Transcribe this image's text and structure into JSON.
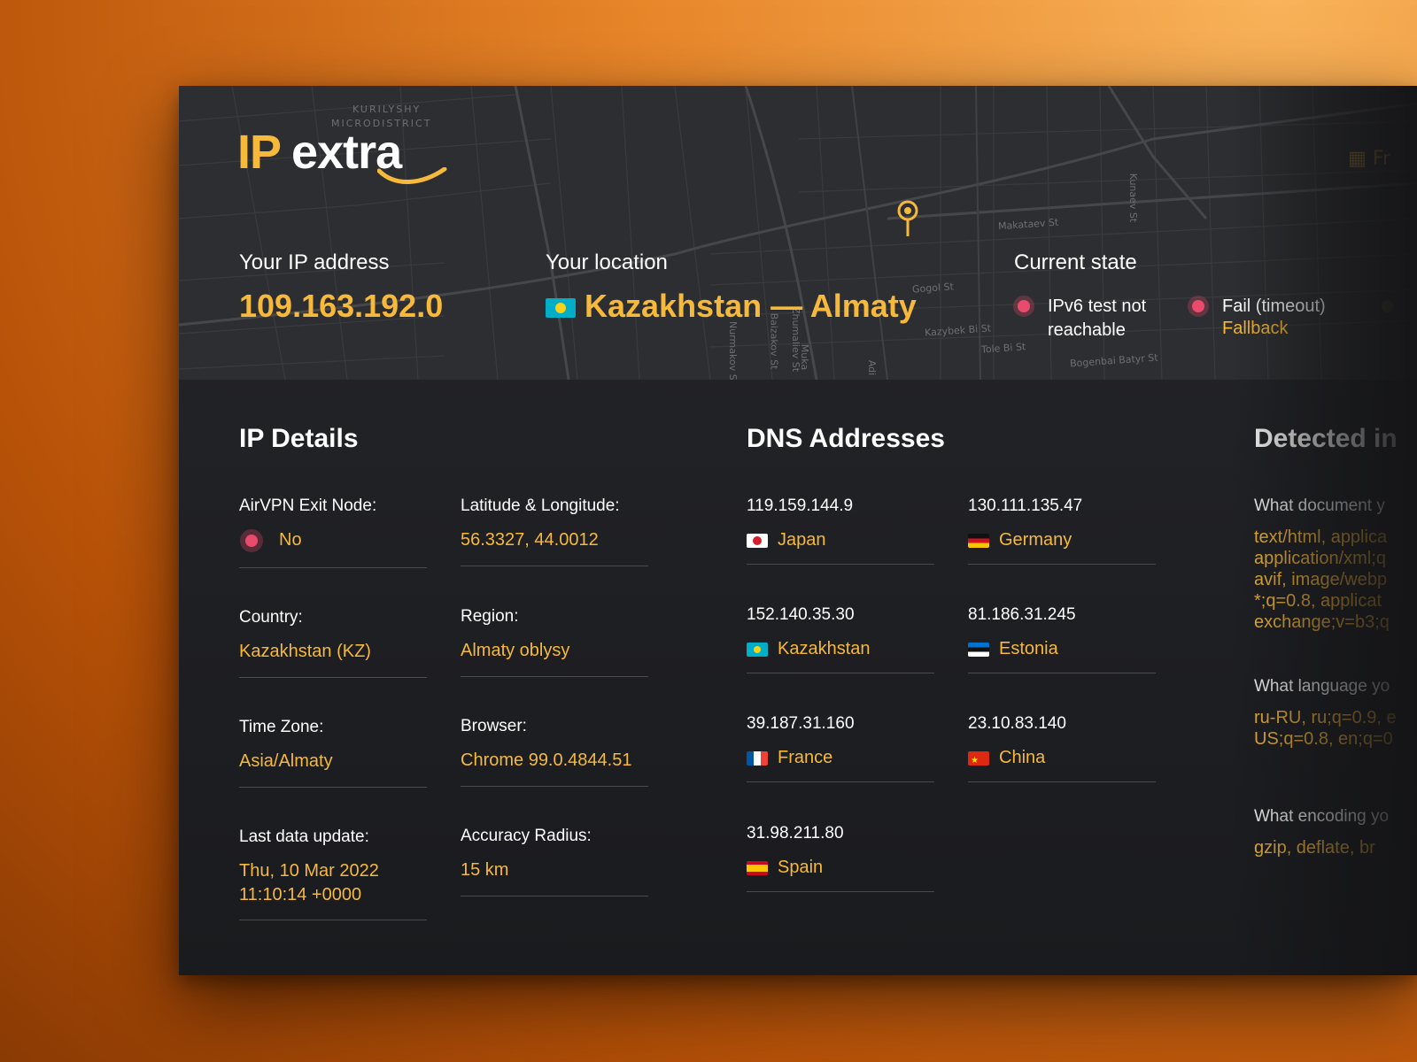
{
  "logo": {
    "ip": "IP",
    "extra": "extra"
  },
  "map_labels": {
    "district_line1": "KURILYSHY",
    "district_line2": "MICRODISTRICT",
    "streets": [
      "Makataev St",
      "Gogol St",
      "Kazybek Bi St",
      "Tole Bi St",
      "Bogenbai Batyr St",
      "Kunaev St",
      "Nurmakov St",
      "Baizakov St",
      "Zhumaliev St",
      "Muka",
      "Adi"
    ]
  },
  "header": {
    "ip_label": "Your IP address",
    "ip_value": "109.163.192.0",
    "location_label": "Your location",
    "location_value": "Kazakhstan — Almaty",
    "state_label": "Current state",
    "states": [
      {
        "text": "IPv6 test not reachable",
        "sub": ""
      },
      {
        "text": "Fail (timeout)",
        "sub": "Fallback"
      }
    ],
    "calendar_icon_text": "Fr"
  },
  "ip_details": {
    "title": "IP Details",
    "fields": [
      {
        "label": "AirVPN Exit Node:",
        "value": "No"
      },
      {
        "label": "Latitude & Longitude:",
        "value": "56.3327, 44.0012"
      },
      {
        "label": "Country:",
        "value": "Kazakhstan (KZ)"
      },
      {
        "label": "Region:",
        "value": "Almaty oblysy"
      },
      {
        "label": "Time Zone:",
        "value": "Asia/Almaty"
      },
      {
        "label": "Browser:",
        "value": "Chrome 99.0.4844.51"
      },
      {
        "label": "Last data update:",
        "value_line1": "Thu, 10 Mar 2022",
        "value_line2": "11:10:14 +0000"
      },
      {
        "label": "Accuracy Radius:",
        "value": "15 km"
      }
    ]
  },
  "dns": {
    "title": "DNS Addresses",
    "entries": [
      {
        "ip": "119.159.144.9",
        "country": "Japan",
        "flag": "jp"
      },
      {
        "ip": "130.111.135.47",
        "country": "Germany",
        "flag": "de"
      },
      {
        "ip": "152.140.35.30",
        "country": "Kazakhstan",
        "flag": "kz"
      },
      {
        "ip": "81.186.31.245",
        "country": "Estonia",
        "flag": "ee"
      },
      {
        "ip": "39.187.31.160",
        "country": "France",
        "flag": "fr"
      },
      {
        "ip": "23.10.83.140",
        "country": "China",
        "flag": "cn"
      },
      {
        "ip": "31.98.211.80",
        "country": "Spain",
        "flag": "es"
      }
    ]
  },
  "detected": {
    "title": "Detected in",
    "items": [
      {
        "label": "What document y",
        "value": "text/html, applica\napplication/xml;q\navif, image/webp\n*;q=0.8, applicat\nexchange;v=b3;q"
      },
      {
        "label": "What language yo",
        "value": "ru-RU, ru;q=0.9, e\nUS;q=0.8, en;q=0"
      },
      {
        "label": "What encoding yo",
        "value": "gzip, deflate, br"
      }
    ]
  },
  "colors": {
    "accent": "#f6b93b",
    "status_red": "#e94b6c",
    "panel_bg": "#26272a",
    "map_bg": "#2d2e31"
  }
}
